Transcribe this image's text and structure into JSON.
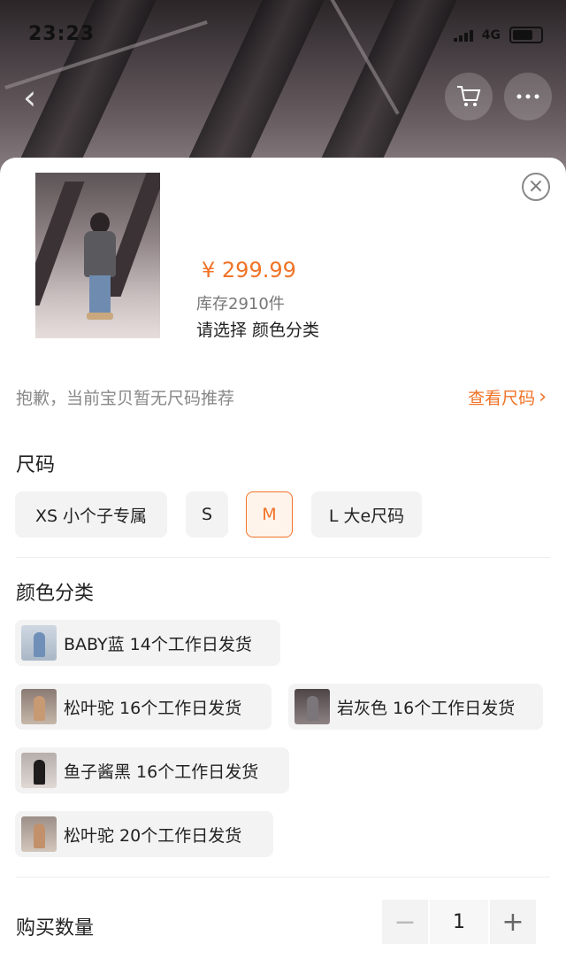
{
  "status_bar": {
    "time": "23:23",
    "network": "4G"
  },
  "product": {
    "price": "¥ 299.99",
    "stock": "库存2910件",
    "prompt": "请选择 颜色分类"
  },
  "size_tip": {
    "text": "抱歉，当前宝贝暂无尺码推荐",
    "link": "查看尺码"
  },
  "size_section": {
    "title": "尺码",
    "options": [
      {
        "label": "XS 小个子专属",
        "selected": false
      },
      {
        "label": "S",
        "selected": false
      },
      {
        "label": "M",
        "selected": true
      },
      {
        "label": "L 大e尺码",
        "selected": false
      }
    ]
  },
  "color_section": {
    "title": "颜色分类",
    "options": [
      {
        "label": "BABY蓝 14个工作日发货"
      },
      {
        "label": "松叶驼 16个工作日发货"
      },
      {
        "label": "岩灰色 16个工作日发货"
      },
      {
        "label": "鱼子酱黑 16个工作日发货"
      },
      {
        "label": "松叶驼 20个工作日发货"
      }
    ]
  },
  "quantity": {
    "label": "购买数量",
    "value": "1",
    "minus": "−",
    "plus": "+"
  },
  "colors": {
    "accent": "#f07327",
    "chip_bg": "#f3f3f3"
  }
}
